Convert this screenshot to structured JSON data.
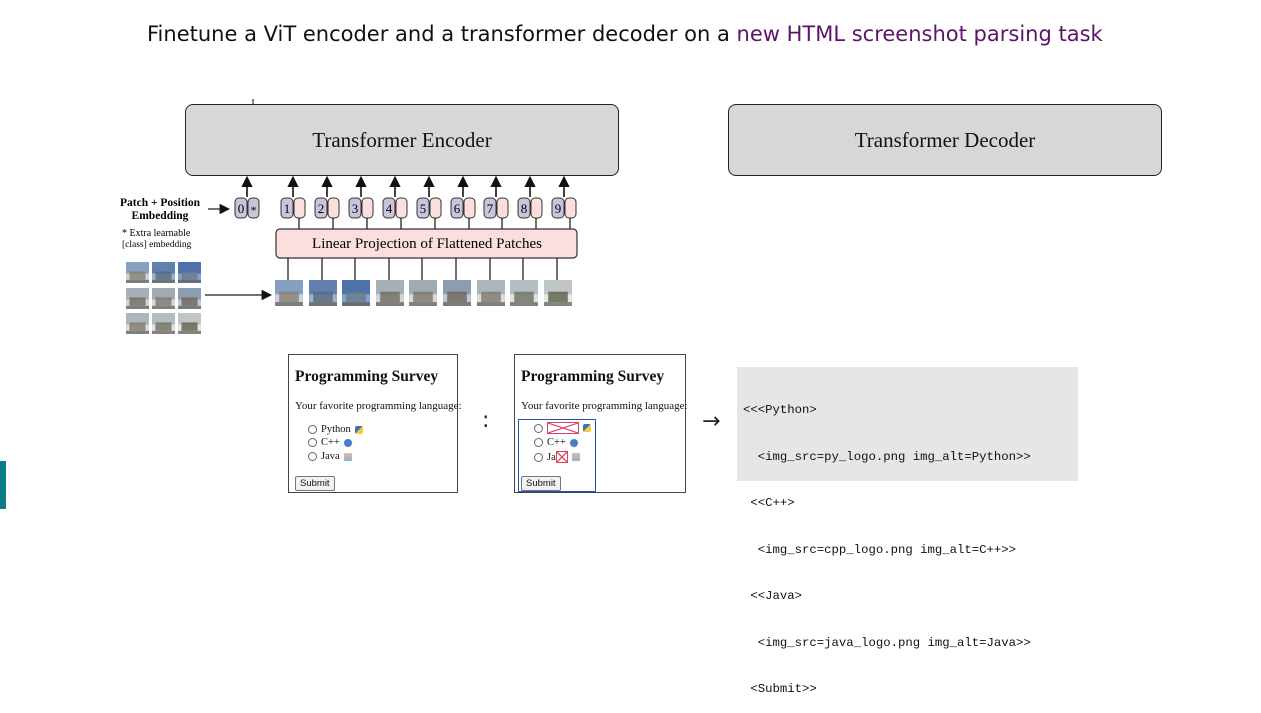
{
  "title": {
    "prefix": "Finetune a ViT encoder and a transformer decoder on a ",
    "highlight": "new HTML screenshot parsing task"
  },
  "colors": {
    "highlight": "#5b1469",
    "block_fill": "#d6d8d5",
    "projection_fill": "#fbdede",
    "token_fill": "#c9c3dc",
    "form_highlight": "#2a4bc4",
    "broken_image": "#e04060",
    "code_bg": "#e6e6e6",
    "side_bar": "#0a7d86"
  },
  "encoder": {
    "label": "Transformer Encoder"
  },
  "decoder": {
    "label": "Transformer Decoder"
  },
  "vit": {
    "embedding_label_1": "Patch + Position",
    "embedding_label_2": "Embedding",
    "extra_note_1": "* Extra learnable",
    "extra_note_2": "[class] embedding",
    "position_tokens": [
      "0",
      "1",
      "2",
      "3",
      "4",
      "5",
      "6",
      "7",
      "8",
      "9"
    ],
    "class_marker": "*",
    "projection_label": "Linear Projection of Flattened Patches"
  },
  "form": {
    "title": "Programming Survey",
    "question": "Your favorite programming language:",
    "options": [
      "Python",
      "C++",
      "Java"
    ],
    "partial_option": "Ja",
    "submit": "Submit"
  },
  "separator": ":",
  "arrow": "→",
  "code_lines": [
    "<<<Python>",
    "  <img_src=py_logo.png img_alt=Python>>",
    " <<C++>",
    "  <img_src=cpp_logo.png img_alt=C++>>",
    " <<Java>",
    "  <img_src=java_logo.png img_alt=Java>>",
    " <Submit>>"
  ]
}
